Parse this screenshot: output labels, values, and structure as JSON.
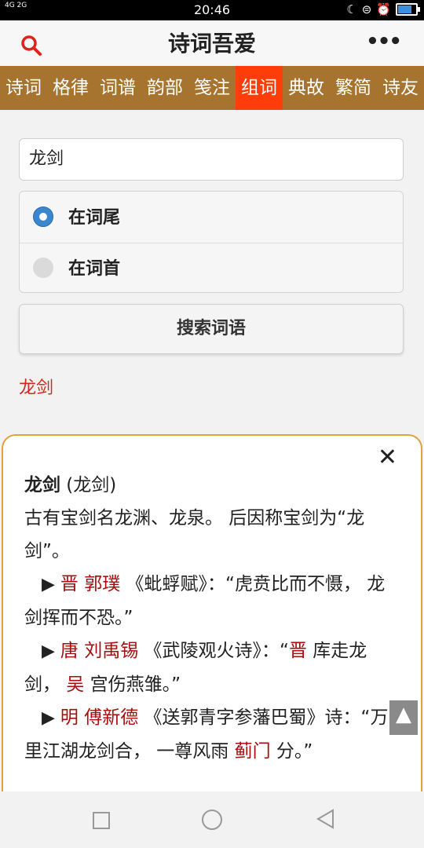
{
  "status_bar": {
    "time": "20:46",
    "signal_text": "4G 2G",
    "icons": [
      "moon-icon",
      "lock-rotation-icon",
      "alarm-icon",
      "battery-icon"
    ]
  },
  "header": {
    "title": "诗词吾爱",
    "more_label": "•••"
  },
  "tabs": [
    {
      "label": "诗词",
      "active": false
    },
    {
      "label": "格律",
      "active": false
    },
    {
      "label": "词谱",
      "active": false
    },
    {
      "label": "韵部",
      "active": false
    },
    {
      "label": "笺注",
      "active": false
    },
    {
      "label": "组词",
      "active": true
    },
    {
      "label": "典故",
      "active": false
    },
    {
      "label": "繁简",
      "active": false
    },
    {
      "label": "诗友",
      "active": false
    }
  ],
  "form": {
    "query_value": "龙剑",
    "radio_options": [
      {
        "label": "在词尾",
        "checked": true
      },
      {
        "label": "在词首",
        "checked": false
      }
    ],
    "search_button": "搜索词语"
  },
  "results": [
    {
      "text": "龙剑"
    }
  ],
  "popup": {
    "close_label": "✕",
    "word": "龙剑",
    "word_paren": " (龙剑)",
    "definition": "古有宝剑名龙渊、龙泉。 后因称宝剑为“龙剑”。",
    "citations": [
      {
        "dynasty": "晋",
        "author": "郭璞",
        "title": "《蚍蜉赋》",
        "quote_parts": [
          {
            "text": "：“虎贲比而不慑， 龙剑挥而不恐。”",
            "red": false
          }
        ]
      },
      {
        "dynasty": "唐",
        "author": "刘禹锡",
        "title": "《武陵观火诗》",
        "quote_parts": [
          {
            "text": "：“",
            "red": false
          },
          {
            "text": "晋",
            "red": true
          },
          {
            "text": " 库走龙剑， ",
            "red": false
          },
          {
            "text": "吴",
            "red": true
          },
          {
            "text": " 宫伤燕雏。”",
            "red": false
          }
        ]
      },
      {
        "dynasty": "明",
        "author": "傅新德",
        "title": "《送郭青字参藩巴蜀》",
        "quote_parts": [
          {
            "text": "诗：“万里江湖龙剑合， 一尊风雨 ",
            "red": false
          },
          {
            "text": "蓟门",
            "red": true
          },
          {
            "text": " 分。”",
            "red": false
          }
        ]
      }
    ]
  },
  "colors": {
    "tab_bar": "#a7742f",
    "tab_active": "#ff3d0a",
    "link_red": "#d3281b",
    "popup_border": "#e0a23a",
    "radio_checked": "#3b87cf"
  }
}
